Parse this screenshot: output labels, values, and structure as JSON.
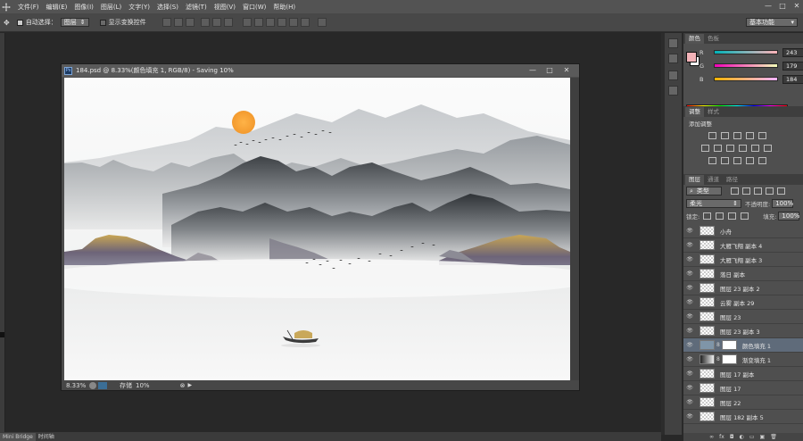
{
  "menu": [
    "文件(F)",
    "编辑(E)",
    "图像(I)",
    "图层(L)",
    "文字(Y)",
    "选择(S)",
    "滤镜(T)",
    "视图(V)",
    "窗口(W)",
    "帮助(H)"
  ],
  "options": {
    "auto_select_label": "自动选择：",
    "auto_select_value": "图层",
    "show_transform_label": "显示变换控件",
    "workspace": "基本功能"
  },
  "document": {
    "title": "184.psd @ 8.33%(颜色填充 1, RGB/8) - Saving 10%",
    "zoom": "8.33%",
    "saving_label": "存储",
    "saving_progress": "10%"
  },
  "color_panel": {
    "tabs": [
      "颜色",
      "色板"
    ],
    "channels": [
      {
        "label": "R",
        "value": "243"
      },
      {
        "label": "G",
        "value": "179"
      },
      {
        "label": "B",
        "value": "184"
      }
    ],
    "fg_color": "#f3b3b8"
  },
  "adjust_panel": {
    "tabs": [
      "调整",
      "样式"
    ],
    "add_label": "添加调整"
  },
  "layers_panel": {
    "tabs": [
      "图层",
      "通道",
      "路径"
    ],
    "filter_kind": "类型",
    "blend_mode": "柔光",
    "opacity_label": "不透明度:",
    "opacity": "100%",
    "lock_label": "锁定:",
    "fill_label": "填充:",
    "fill": "100%",
    "layers": [
      {
        "name": "小舟",
        "type": "normal"
      },
      {
        "name": "大雁飞翔 副本 4",
        "type": "normal"
      },
      {
        "name": "大雁飞翔 副本 3",
        "type": "normal"
      },
      {
        "name": "落日  副本",
        "type": "normal"
      },
      {
        "name": "图层 23 副本 2",
        "type": "normal"
      },
      {
        "name": "云雾 副本 29",
        "type": "normal"
      },
      {
        "name": "图层 23",
        "type": "normal"
      },
      {
        "name": "图层 23 副本 3",
        "type": "normal"
      },
      {
        "name": "颜色填充 1",
        "type": "fill",
        "selected": true
      },
      {
        "name": "渐变填充 1",
        "type": "gradient"
      },
      {
        "name": "图层 17 副本",
        "type": "normal"
      },
      {
        "name": "图层 17",
        "type": "normal"
      },
      {
        "name": "图层 22",
        "type": "normal"
      },
      {
        "name": "图层 182 副本 5",
        "type": "normal"
      }
    ]
  },
  "bottom_tabs": [
    "Mini Bridge",
    "时间轴"
  ]
}
